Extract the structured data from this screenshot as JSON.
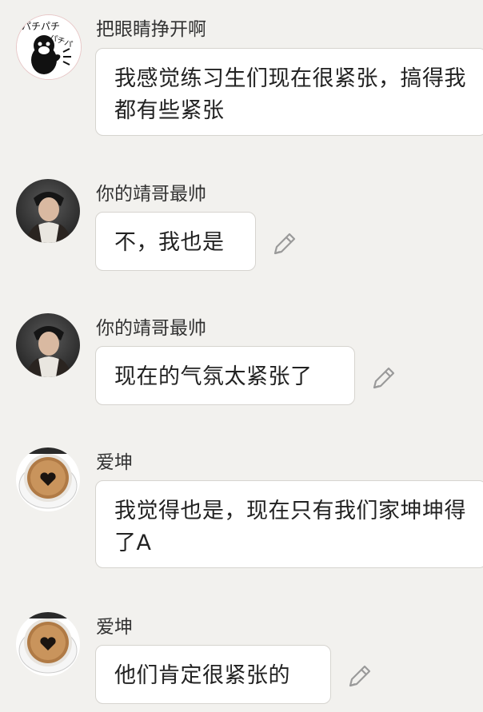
{
  "messages": [
    {
      "sender": "把眼睛挣开啊",
      "avatar_icon": "penguin-clapping-avatar",
      "avatar_text": "パチパチ",
      "text": "我感觉练习生们现在很紧张，搞得我都有些紧张",
      "editable": false
    },
    {
      "sender": "你的靖哥最帅",
      "avatar_icon": "person-photo-avatar",
      "text": "不，我也是",
      "editable": true
    },
    {
      "sender": "你的靖哥最帅",
      "avatar_icon": "person-photo-avatar",
      "text": "现在的气氛太紧张了",
      "editable": true
    },
    {
      "sender": "爱坤",
      "avatar_icon": "coffee-cup-heart-avatar",
      "text": "我觉得也是，现在只有我们家坤坤得了A",
      "editable": false
    },
    {
      "sender": "爱坤",
      "avatar_icon": "coffee-cup-heart-avatar",
      "text": "他们肯定很紧张的",
      "editable": true
    }
  ],
  "colors": {
    "background": "#f2f1ee",
    "bubble": "#ffffff",
    "bubble_border": "#d6d4cf",
    "text": "#222222",
    "name": "#333333",
    "pencil": "#9a9a9a"
  }
}
